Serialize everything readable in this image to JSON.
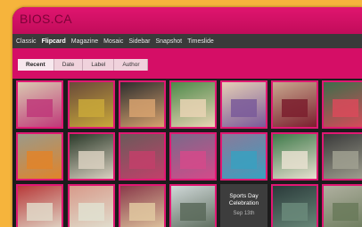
{
  "header": {
    "title": "BIOS.CA"
  },
  "nav": {
    "items": [
      "Classic",
      "Flipcard",
      "Magazine",
      "Mosaic",
      "Sidebar",
      "Snapshot",
      "Timeslide"
    ],
    "active": "Flipcard"
  },
  "sort": {
    "items": [
      "Recent",
      "Date",
      "Label",
      "Author"
    ],
    "active": "Recent"
  },
  "photos": [
    {
      "name": "photo-award-ceremony-banner",
      "colors": [
        "#d9c9b0",
        "#c03a7a"
      ]
    },
    {
      "name": "photo-crowd-event",
      "colors": [
        "#6a4a3a",
        "#c9a83a"
      ]
    },
    {
      "name": "photo-art-display",
      "colors": [
        "#2e2e2e",
        "#d7a26e"
      ]
    },
    {
      "name": "photo-green-decoration",
      "colors": [
        "#4d8a4a",
        "#e9d4b4"
      ]
    },
    {
      "name": "photo-wall-chart",
      "colors": [
        "#e5cfb5",
        "#7a5a9a"
      ]
    },
    {
      "name": "photo-stage-guests",
      "colors": [
        "#c8a98e",
        "#7b1e2e"
      ]
    },
    {
      "name": "photo-rangoli-one",
      "colors": [
        "#3d6e4a",
        "#d94a5a"
      ]
    },
    {
      "name": "photo-rangoli-two",
      "colors": [
        "#9a9a8a",
        "#e0842a"
      ]
    },
    {
      "name": "photo-blackboard",
      "colors": [
        "#2b3a2a",
        "#d9d0c0"
      ]
    },
    {
      "name": "photo-students-row",
      "colors": [
        "#6b5a5a",
        "#c2406a"
      ]
    },
    {
      "name": "photo-dance-performance",
      "colors": [
        "#7a6a8a",
        "#d44a8a"
      ]
    },
    {
      "name": "photo-dance-group",
      "colors": [
        "#8a7a9a",
        "#3aa0c0"
      ]
    },
    {
      "name": "photo-certificate-frame",
      "colors": [
        "#3e7a4a",
        "#e8e0d0"
      ]
    },
    {
      "name": "photo-classroom-board",
      "colors": [
        "#3a3a3a",
        "#a0a090"
      ]
    },
    {
      "name": "photo-red-stage",
      "colors": [
        "#b83a3a",
        "#e0d8c8"
      ]
    },
    {
      "name": "photo-prize-certificate",
      "colors": [
        "#d89a8a",
        "#e0e0d0"
      ]
    },
    {
      "name": "photo-stage-lineup",
      "colors": [
        "#8a3a4a",
        "#e0c8a0"
      ]
    },
    {
      "name": "photo-hall-audience",
      "colors": [
        "#d0d8d8",
        "#5a6a5a"
      ]
    },
    {
      "name": "photo-classroom-students",
      "colors": [
        "#2a3a3a",
        "#6a8a7a"
      ]
    },
    {
      "name": "photo-outdoor-gathering",
      "colors": [
        "#b0b0a0",
        "#6a7a5a"
      ]
    },
    {
      "name": "photo-colorful-crowd",
      "colors": [
        "#6a6a5a",
        "#c04a6a"
      ]
    }
  ],
  "event_card": {
    "title": "Sports Day Celebration",
    "date": "Sep 13th"
  }
}
